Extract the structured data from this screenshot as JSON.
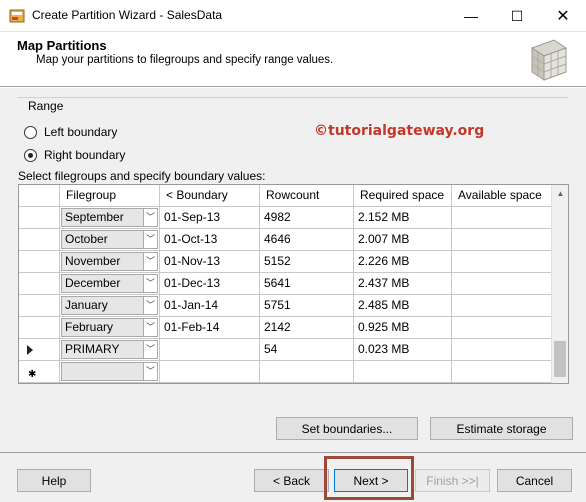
{
  "window": {
    "title": "Create Partition Wizard - SalesData"
  },
  "header": {
    "title": "Map Partitions",
    "subtitle": "Map your partitions to filegroups and specify range values."
  },
  "range": {
    "label": "Range",
    "options": [
      {
        "label": "Left boundary",
        "checked": false
      },
      {
        "label": "Right boundary",
        "checked": true
      }
    ]
  },
  "watermark": "©tutorialgateway.org",
  "grid": {
    "label": "Select filegroups and specify boundary values:",
    "columns": [
      "Filegroup",
      "< Boundary",
      "Rowcount",
      "Required space",
      "Available space"
    ],
    "rows": [
      {
        "filegroup": "September",
        "boundary": "01-Sep-13",
        "rowcount": "4982",
        "required": "2.152 MB",
        "available": ""
      },
      {
        "filegroup": "October",
        "boundary": "01-Oct-13",
        "rowcount": "4646",
        "required": "2.007 MB",
        "available": ""
      },
      {
        "filegroup": "November",
        "boundary": "01-Nov-13",
        "rowcount": "5152",
        "required": "2.226 MB",
        "available": ""
      },
      {
        "filegroup": "December",
        "boundary": "01-Dec-13",
        "rowcount": "5641",
        "required": "2.437 MB",
        "available": ""
      },
      {
        "filegroup": "January",
        "boundary": "01-Jan-14",
        "rowcount": "5751",
        "required": "2.485 MB",
        "available": ""
      },
      {
        "filegroup": "February",
        "boundary": "01-Feb-14",
        "rowcount": "2142",
        "required": "0.925 MB",
        "available": ""
      },
      {
        "filegroup": "PRIMARY",
        "boundary": "",
        "rowcount": "54",
        "required": "0.023 MB",
        "available": ""
      },
      {
        "filegroup": "",
        "boundary": "",
        "rowcount": "",
        "required": "",
        "available": ""
      }
    ]
  },
  "buttons": {
    "set_boundaries": "Set boundaries...",
    "estimate_storage": "Estimate storage",
    "help": "Help",
    "back": "< Back",
    "next": "Next >",
    "finish": "Finish >>|",
    "cancel": "Cancel"
  },
  "icons": {
    "minimize": "minimize-icon",
    "maximize": "maximize-icon",
    "close": "close-icon",
    "dropdown": "chevron-down-icon",
    "current_row": "row-pointer-icon",
    "new_row": "new-row-icon"
  },
  "colors": {
    "watermark": "#c0392b",
    "highlight": "#9b4a3a",
    "accent": "#0078d7"
  }
}
